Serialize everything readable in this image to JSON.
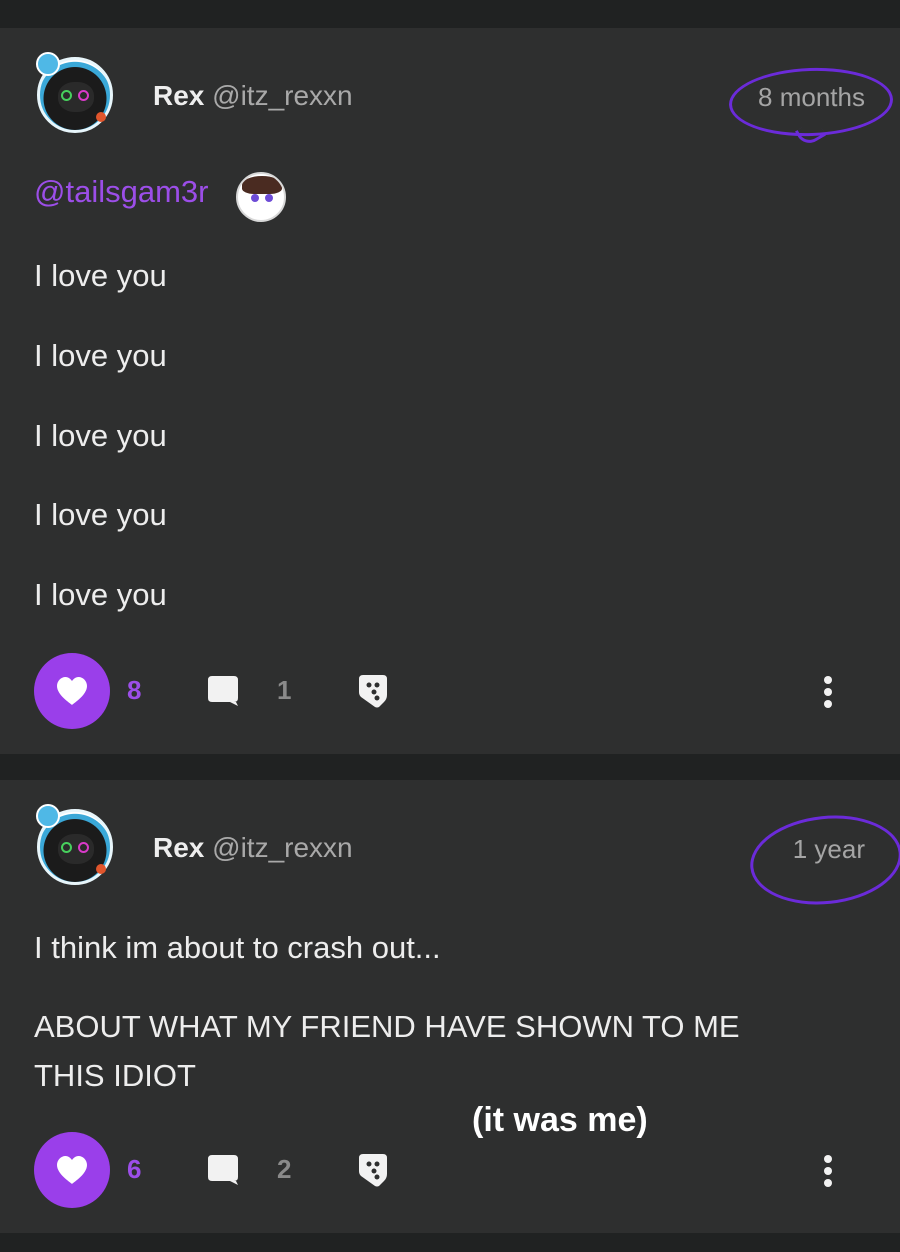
{
  "posts": [
    {
      "author_name": "Rex",
      "author_handle": "@itz_rexxn",
      "time": "8 months",
      "mention": "@tailsgam3r",
      "lines": [
        "I love you",
        "I love you",
        "I love you",
        "I love you",
        "I love you"
      ],
      "likes": "8",
      "comments": "1"
    },
    {
      "author_name": "Rex",
      "author_handle": "@itz_rexxn",
      "time": "1 year",
      "lines": [
        "I think im about to crash out...",
        "ABOUT WHAT MY FRIEND HAVE SHOWN TO ME",
        "THIS IDIOT"
      ],
      "likes": "6",
      "comments": "2"
    }
  ],
  "overlay_caption": "(it was me)",
  "colors": {
    "background": "#202222",
    "card": "#2e2f2f",
    "accent": "#9a3fea",
    "annotation_circle": "#6b2bd9"
  },
  "icons": [
    "heart-icon",
    "comment-icon",
    "share-icon",
    "more-vertical-icon"
  ]
}
